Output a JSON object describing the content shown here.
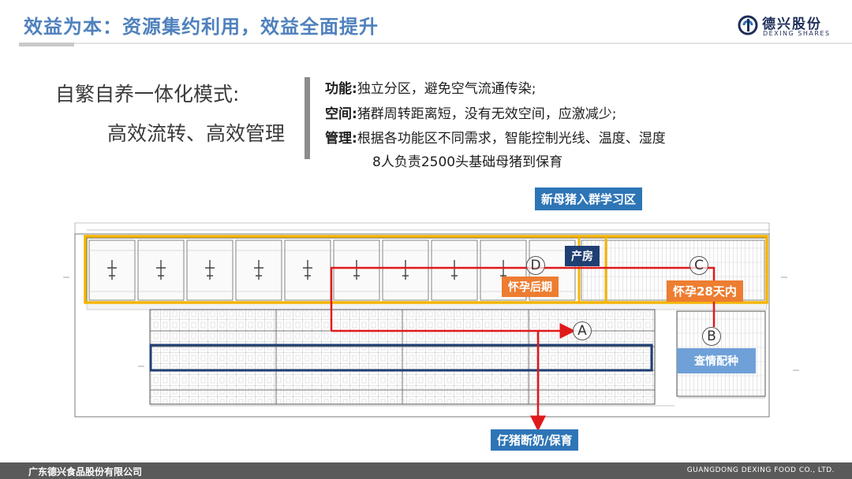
{
  "header": {
    "title": "效益为本：资源集约利用，效益全面提升",
    "logo_cn": "德兴股份",
    "logo_en": "DEXING SHARES"
  },
  "mode": {
    "line1": "自繁自养一体化模式:",
    "line2": "高效流转、高效管理"
  },
  "features": [
    {
      "key": "功能:",
      "text": "独立分区，避免空气流通传染;"
    },
    {
      "key": "空间:",
      "text": "猪群周转距离短，没有无效空间，应激减少;"
    },
    {
      "key": "管理:",
      "text": "根据各功能区不同需求，智能控制光线、温度、湿度"
    },
    {
      "key": "",
      "text": "8人负责2500头基础母猪到保育"
    }
  ],
  "plan": {
    "labels": {
      "new_sow": "新母猪入群学习区",
      "farrowing": "产房",
      "late_pregnancy": "怀孕后期",
      "early_pregnancy": "怀孕28天内",
      "heat_check": "查情配种",
      "weaning": "仔猪断奶/保育"
    },
    "zones": [
      "A",
      "B",
      "C",
      "D"
    ],
    "colors": {
      "orange": "#f4b400",
      "navy": "#1f3f73",
      "red": "#e0191b",
      "blue": "#2e75b6"
    }
  },
  "footer": {
    "company_cn": "广东德兴食品股份有限公司",
    "company_en": "GUANGDONG DEXING FOOD CO., LTD."
  }
}
